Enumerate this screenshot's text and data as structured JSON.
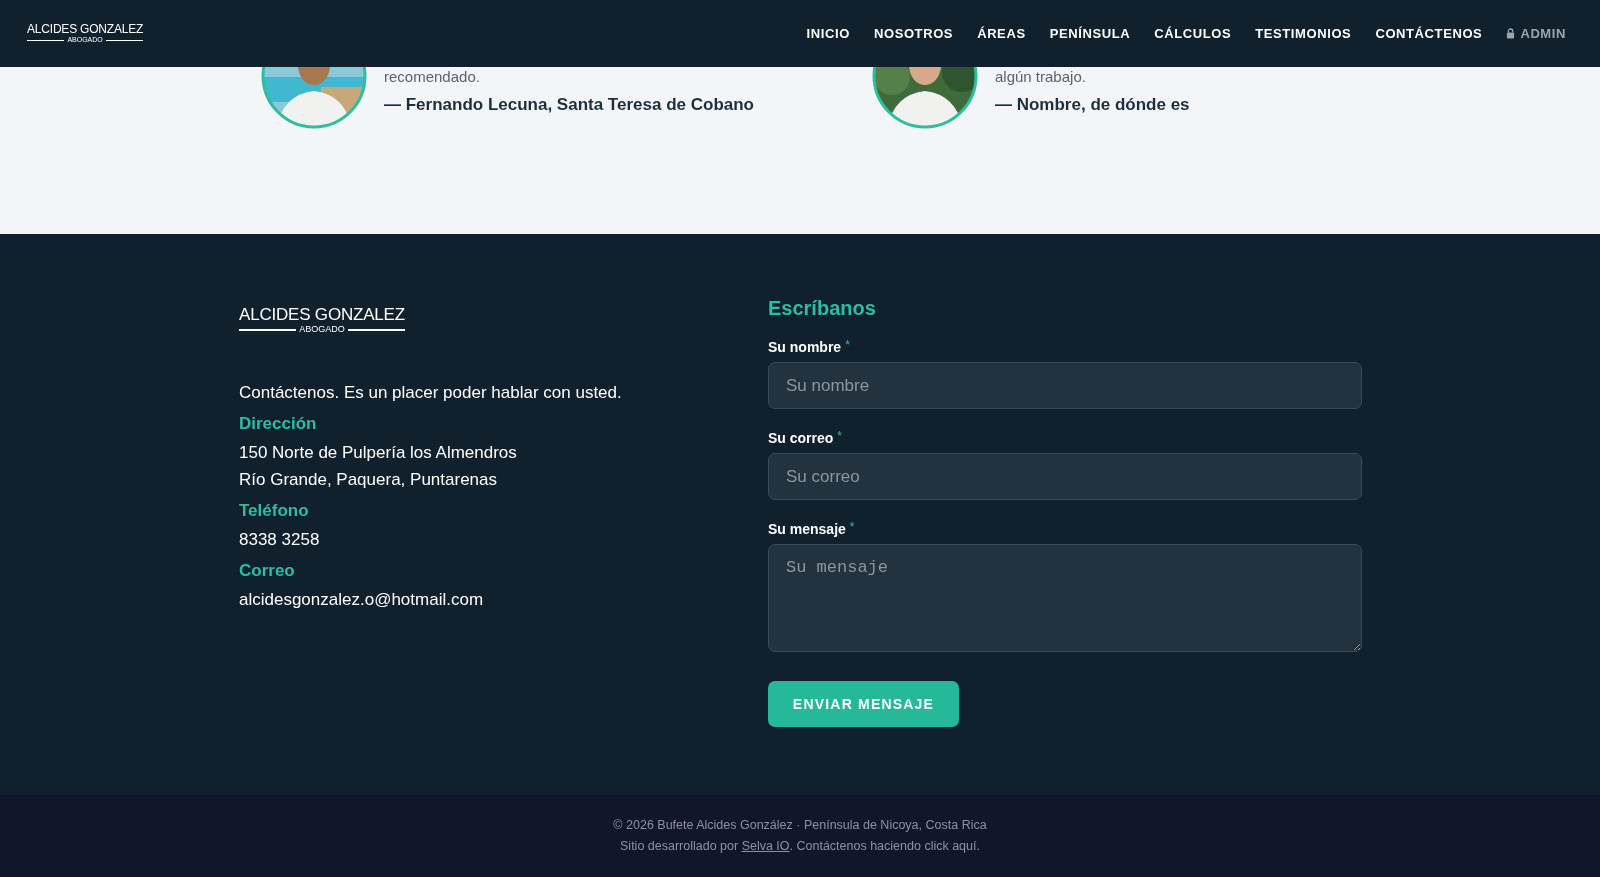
{
  "header": {
    "logo": {
      "name": "ALCIDES GONZALEZ",
      "tagline": "ABOGADO"
    },
    "nav": [
      {
        "label": "INICIO",
        "kind": "link"
      },
      {
        "label": "NOSOTROS",
        "kind": "link"
      },
      {
        "label": "ÁREAS",
        "kind": "link"
      },
      {
        "label": "PENÍNSULA",
        "kind": "link"
      },
      {
        "label": "CÁLCULOS",
        "kind": "link"
      },
      {
        "label": "TESTIMONIOS",
        "kind": "link"
      },
      {
        "label": "CONTÁCTENOS",
        "kind": "link"
      },
      {
        "label": "ADMIN",
        "kind": "locked"
      }
    ]
  },
  "testimonials": [
    {
      "quote": "recomendado.",
      "author": "— Fernando Lecuna, Santa Teresa de Cobano"
    },
    {
      "quote": "algún trabajo.",
      "author": "— Nombre, de dónde es"
    }
  ],
  "footer": {
    "logo": {
      "name": "ALCIDES GONZALEZ",
      "tagline": "ABOGADO"
    },
    "intro": "Contáctenos. Es un placer poder hablar con usted.",
    "sections": [
      {
        "heading": "Dirección",
        "lines": [
          "150 Norte de Pulpería los Almendros",
          "Río Grande, Paquera, Puntarenas"
        ]
      },
      {
        "heading": "Teléfono",
        "lines": [
          "8338 3258"
        ]
      },
      {
        "heading": "Correo",
        "lines": [
          "alcidesgonzalez.o@hotmail.com"
        ]
      }
    ],
    "form": {
      "title": "Escríbanos",
      "fields": [
        {
          "label": "Su nombre",
          "required_mark": "*",
          "kind": "input",
          "placeholder": "Su nombre"
        },
        {
          "label": "Su correo",
          "required_mark": "*",
          "kind": "input",
          "placeholder": "Su correo"
        },
        {
          "label": "Su mensaje",
          "required_mark": "*",
          "kind": "textarea",
          "placeholder": "Su mensaje"
        }
      ],
      "submit": "ENVIAR MENSAJE"
    }
  },
  "bottom_bar": {
    "copyright": "© 2026 Bufete Alcides González · Península de Nicoya, Costa Rica",
    "credit_before": "Sitio desarrollado por ",
    "credit_link": "Selva IO",
    "credit_after": ". Contáctenos haciendo click aquí."
  }
}
